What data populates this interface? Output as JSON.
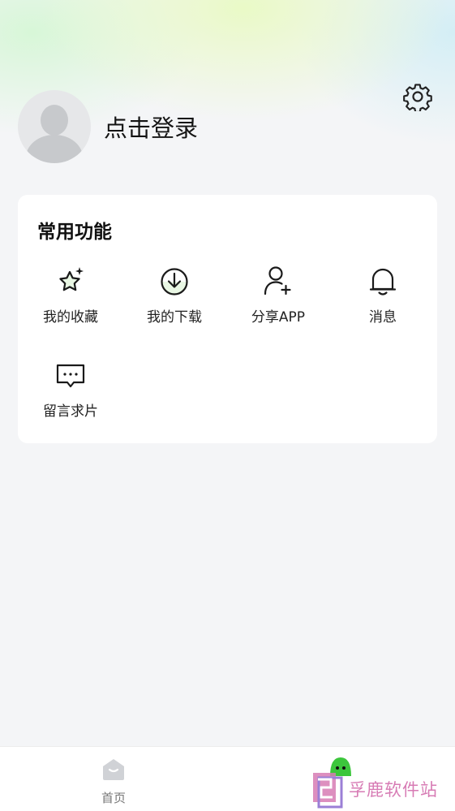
{
  "header": {
    "login_text": "点击登录"
  },
  "functions_card": {
    "title": "常用功能",
    "items": [
      {
        "label": "我的收藏",
        "icon": "star-sparkle-icon"
      },
      {
        "label": "我的下载",
        "icon": "download-icon"
      },
      {
        "label": "分享APP",
        "icon": "add-user-icon"
      },
      {
        "label": "消息",
        "icon": "bell-icon"
      },
      {
        "label": "留言求片",
        "icon": "message-bubble-icon"
      }
    ]
  },
  "tabbar": {
    "tabs": [
      {
        "label": "首页",
        "icon": "home-icon",
        "active": false
      },
      {
        "label": "",
        "icon": "profile-face-icon",
        "active": true
      }
    ]
  },
  "watermark": {
    "text": "孚鹿软件站"
  },
  "colors": {
    "accent_green": "#3cc63c",
    "inactive_gray": "#c9cbcf",
    "watermark_pink": "#d77bb4",
    "card_bg": "#ffffff",
    "page_bg": "#f4f5f7"
  }
}
